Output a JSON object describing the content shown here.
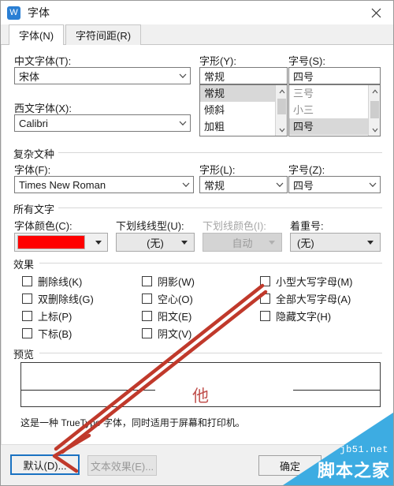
{
  "window": {
    "title": "字体",
    "app_icon": "wps-writer-icon",
    "close_label": "×"
  },
  "tabs": [
    {
      "label": "字体(N)",
      "active": true
    },
    {
      "label": "字符间距(R)",
      "active": false
    }
  ],
  "chinese_font": {
    "label": "中文字体(T):",
    "value": "宋体"
  },
  "latin_font": {
    "label": "西文字体(X):",
    "value": "Calibri"
  },
  "font_style": {
    "label": "字形(Y):",
    "value": "常规",
    "options": [
      "常规",
      "倾斜",
      "加粗"
    ],
    "selected_index": 0
  },
  "font_size": {
    "label": "字号(S):",
    "value": "四号",
    "options": [
      "三号",
      "小三",
      "四号"
    ],
    "selected_index": 2
  },
  "complex_script": {
    "group_title": "复杂文种",
    "font": {
      "label": "字体(F):",
      "value": "Times New Roman"
    },
    "style": {
      "label": "字形(L):",
      "value": "常规"
    },
    "size": {
      "label": "字号(Z):",
      "value": "四号"
    }
  },
  "all_text": {
    "group_title": "所有文字",
    "font_color": {
      "label": "字体颜色(C):",
      "value": "#FF0000",
      "disabled": false
    },
    "underline_style": {
      "label": "下划线线型(U):",
      "value": "(无)",
      "disabled": false
    },
    "underline_color": {
      "label": "下划线颜色(I):",
      "value": "自动",
      "disabled": true
    },
    "emphasis_mark": {
      "label": "着重号:",
      "value": "(无)",
      "disabled": false
    }
  },
  "effects": {
    "group_title": "效果",
    "left_column": [
      {
        "label": "删除线(K)",
        "checked": false
      },
      {
        "label": "双删除线(G)",
        "checked": false
      },
      {
        "label": "上标(P)",
        "checked": false
      },
      {
        "label": "下标(B)",
        "checked": false
      }
    ],
    "middle_column": [
      {
        "label": "阴影(W)",
        "checked": false
      },
      {
        "label": "空心(O)",
        "checked": false
      },
      {
        "label": "阳文(E)",
        "checked": false
      },
      {
        "label": "阴文(V)",
        "checked": false
      }
    ],
    "right_column": [
      {
        "label": "小型大写字母(M)",
        "checked": false
      },
      {
        "label": "全部大写字母(A)",
        "checked": false
      },
      {
        "label": "隐藏文字(H)",
        "checked": false
      }
    ]
  },
  "preview": {
    "group_title": "预览",
    "sample_text": "他",
    "sample_color": "#C0504D",
    "footnote": "这是一种 TrueType 字体，同时适用于屏幕和打印机。"
  },
  "buttons": {
    "default": "默认(D)...",
    "text_effects": "文本效果(E)...",
    "ok": "确定"
  },
  "annotation": {
    "color": "#C0392B",
    "arrow_count": 2,
    "points_from": "小型大写字母(M)",
    "points_to": "默认(D)..."
  },
  "watermark": {
    "url": "jb51.net",
    "site": "脚本之家",
    "color": "#3DACE2"
  }
}
